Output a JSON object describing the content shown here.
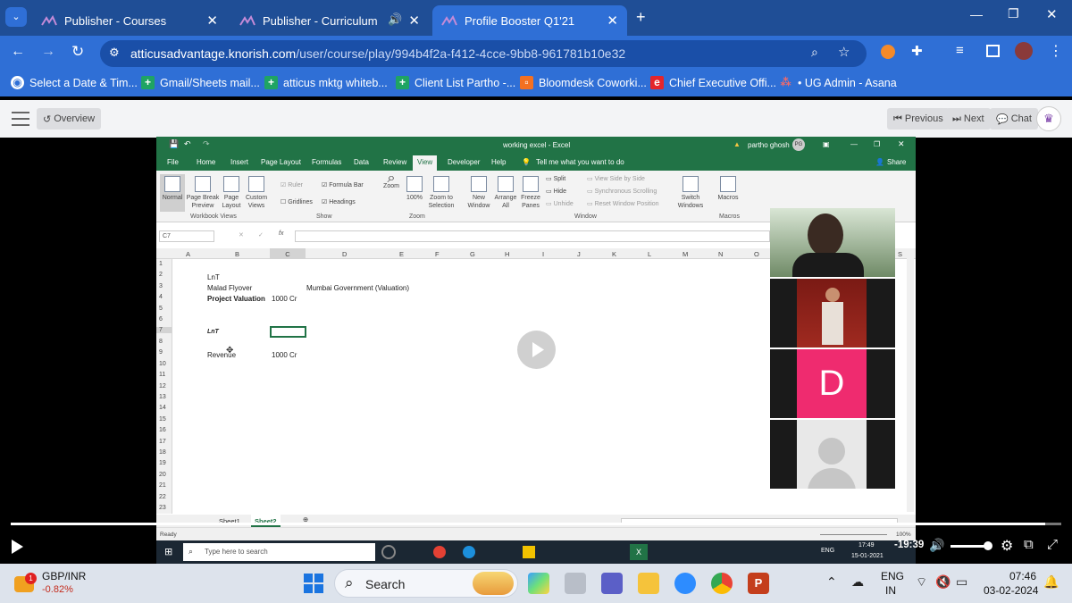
{
  "tabs": [
    {
      "label": "Publisher - Courses"
    },
    {
      "label": "Publisher - Curriculum"
    },
    {
      "label": "Profile Booster Q1'21"
    }
  ],
  "address": {
    "host": "atticusadvantage.knorish.com",
    "path": "/user/course/play/994b4f2a-f412-4cce-9bb8-961781b10e32"
  },
  "bookmarks": [
    {
      "label": "Select a Date & Tim..."
    },
    {
      "label": "Gmail/Sheets mail..."
    },
    {
      "label": "atticus mktg whiteb..."
    },
    {
      "label": "Client List Partho -..."
    },
    {
      "label": "Bloomdesk Coworki..."
    },
    {
      "label": "Chief Executive Offi..."
    },
    {
      "label": "• UG Admin - Asana"
    }
  ],
  "player": {
    "overview": "Overview",
    "previous": "Previous",
    "next": "Next",
    "chat": "Chat"
  },
  "excel": {
    "title": "working excel  -  Excel",
    "user": "partho ghosh",
    "user_initials": "PG",
    "share": "Share",
    "menu": [
      "File",
      "Home",
      "Insert",
      "Page Layout",
      "Formulas",
      "Data",
      "Review",
      "View",
      "Developer",
      "Help",
      "Tell me what you want to do"
    ],
    "ribbon": {
      "normal": "Normal",
      "page_break": "Page Break Preview",
      "page_layout": "Page Layout",
      "custom_views": "Custom Views",
      "ruler": "Ruler",
      "formula_bar": "Formula Bar",
      "gridlines": "Gridlines",
      "headings": "Headings",
      "zoom": "Zoom",
      "zoom100": "100%",
      "zoom_sel": "Zoom to Selection",
      "new_window": "New Window",
      "arrange_all": "Arrange All",
      "freeze": "Freeze Panes",
      "split": "Split",
      "hide": "Hide",
      "unhide": "Unhide",
      "view_side": "View Side by Side",
      "sync_scroll": "Synchronous Scrolling",
      "reset_pos": "Reset Window Position",
      "switch_win": "Switch Windows",
      "macros": "Macros",
      "g_workbook": "Workbook Views",
      "g_show": "Show",
      "g_zoom": "Zoom",
      "g_window": "Window",
      "g_macros": "Macros"
    },
    "namebox": "C7",
    "columns": [
      "A",
      "B",
      "C",
      "D",
      "E",
      "F",
      "G",
      "H",
      "I",
      "J",
      "K",
      "L",
      "M",
      "N",
      "O",
      "S"
    ],
    "rows": [
      "1",
      "2",
      "3",
      "4",
      "5",
      "6",
      "7",
      "8",
      "9",
      "10",
      "11",
      "12",
      "13",
      "14",
      "15",
      "16",
      "17",
      "18",
      "19",
      "20",
      "21",
      "22",
      "23"
    ],
    "cells": {
      "b2": "LnT",
      "b3": "Malad Flyover",
      "d3": "Mumbai Government  (Valuation)",
      "b4": "Project Valuation",
      "c4": "1000 Cr",
      "b7": "LnT",
      "b9": "Revenue",
      "c9": "1000 Cr"
    },
    "sheets": [
      "Sheet1",
      "Sheet2"
    ],
    "status_ready": "Ready",
    "zoom_pct": "100%",
    "inner_search": "Type here to search",
    "inner_time": "17:49",
    "inner_date": "15-01-2021",
    "inner_lang": "ENG"
  },
  "video": {
    "time": "-19:39",
    "progress": 0.985
  },
  "webcam": {
    "initial": "D"
  },
  "taskbar": {
    "stock_name": "GBP/INR",
    "stock_change": "-0.82%",
    "search": "Search",
    "lang1": "ENG",
    "lang2": "IN",
    "time": "07:46",
    "date": "03-02-2024"
  },
  "colors": {
    "tab_bar": "#1f4e96",
    "chrome": "#2f6fd6",
    "excel_green": "#217346",
    "avatar_pink": "#ef2b6f"
  }
}
